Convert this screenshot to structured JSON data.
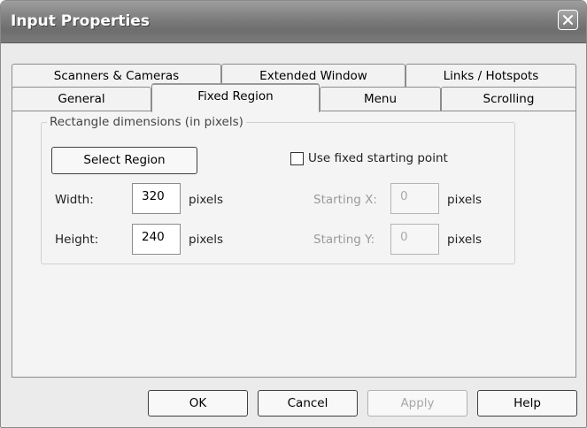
{
  "window": {
    "title": "Input Properties"
  },
  "tabs": {
    "row_back": [
      "Scanners & Cameras",
      "Extended Window",
      "Links / Hotspots"
    ],
    "row_front": [
      "General",
      "Fixed Region",
      "Menu",
      "Scrolling"
    ],
    "active": "Fixed Region"
  },
  "group": {
    "label": "Rectangle dimensions (in pixels)"
  },
  "select_region": {
    "label": "Select Region"
  },
  "use_fixed": {
    "label": "Use fixed starting point",
    "checked": false
  },
  "width": {
    "label": "Width:",
    "value": "320",
    "unit": "pixels"
  },
  "height": {
    "label": "Height:",
    "value": "240",
    "unit": "pixels"
  },
  "start_x": {
    "label": "Starting X:",
    "value": "0",
    "unit": "pixels"
  },
  "start_y": {
    "label": "Starting Y:",
    "value": "0",
    "unit": "pixels"
  },
  "buttons": {
    "ok": "OK",
    "cancel": "Cancel",
    "apply": "Apply",
    "help": "Help"
  }
}
